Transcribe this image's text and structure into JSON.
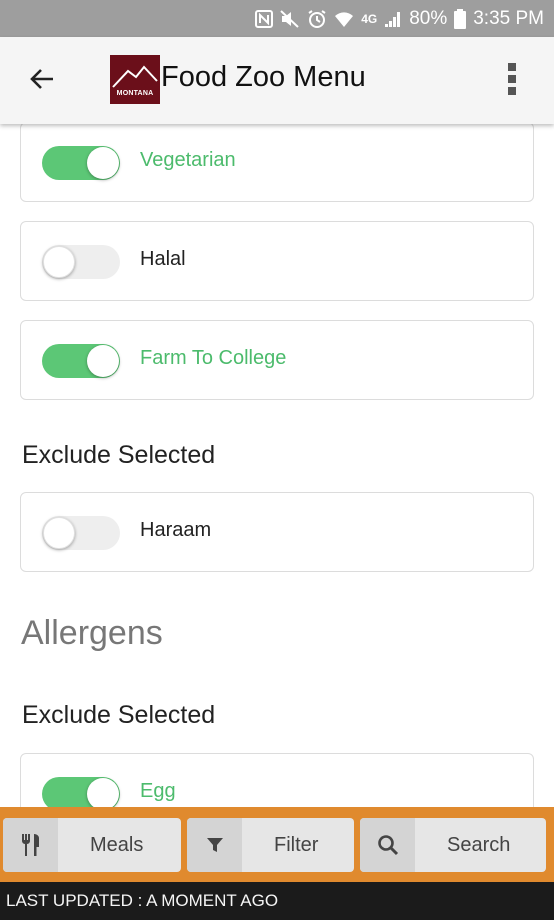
{
  "status_bar": {
    "battery": "80%",
    "time": "3:35 PM",
    "network": "4G",
    "icons": [
      "nfc-icon",
      "mute-icon",
      "alarm-icon",
      "wifi-icon",
      "lte-icon",
      "signal-icon",
      "battery-icon"
    ]
  },
  "app_bar": {
    "title": "Food Zoo Menu",
    "logo_text": "MONTANA",
    "back_icon": "back-arrow-icon",
    "menu_icon": "more-vert-icon"
  },
  "preferences": {
    "items": [
      {
        "label": "Vegetarian",
        "enabled": true
      },
      {
        "label": "Halal",
        "enabled": false
      },
      {
        "label": "Farm To College",
        "enabled": true
      }
    ]
  },
  "exclude_section_1": {
    "title": "Exclude Selected",
    "items": [
      {
        "label": "Haraam",
        "enabled": false
      }
    ]
  },
  "allergens": {
    "title": "Allergens",
    "exclude_title": "Exclude Selected",
    "items": [
      {
        "label": "Egg",
        "enabled": true
      }
    ]
  },
  "tabs": [
    {
      "label": "Meals",
      "icon": "utensils-icon"
    },
    {
      "label": "Filter",
      "icon": "filter-icon"
    },
    {
      "label": "Search",
      "icon": "search-icon"
    }
  ],
  "footer": {
    "text": "LAST UPDATED : A MOMENT AGO"
  },
  "colors": {
    "accent_green": "#4cbb6c",
    "toggle_on": "#5cc776",
    "tab_bar": "#e08a2e",
    "logo_bg": "#6b0f1a",
    "status_bar": "#9e9e9e"
  }
}
